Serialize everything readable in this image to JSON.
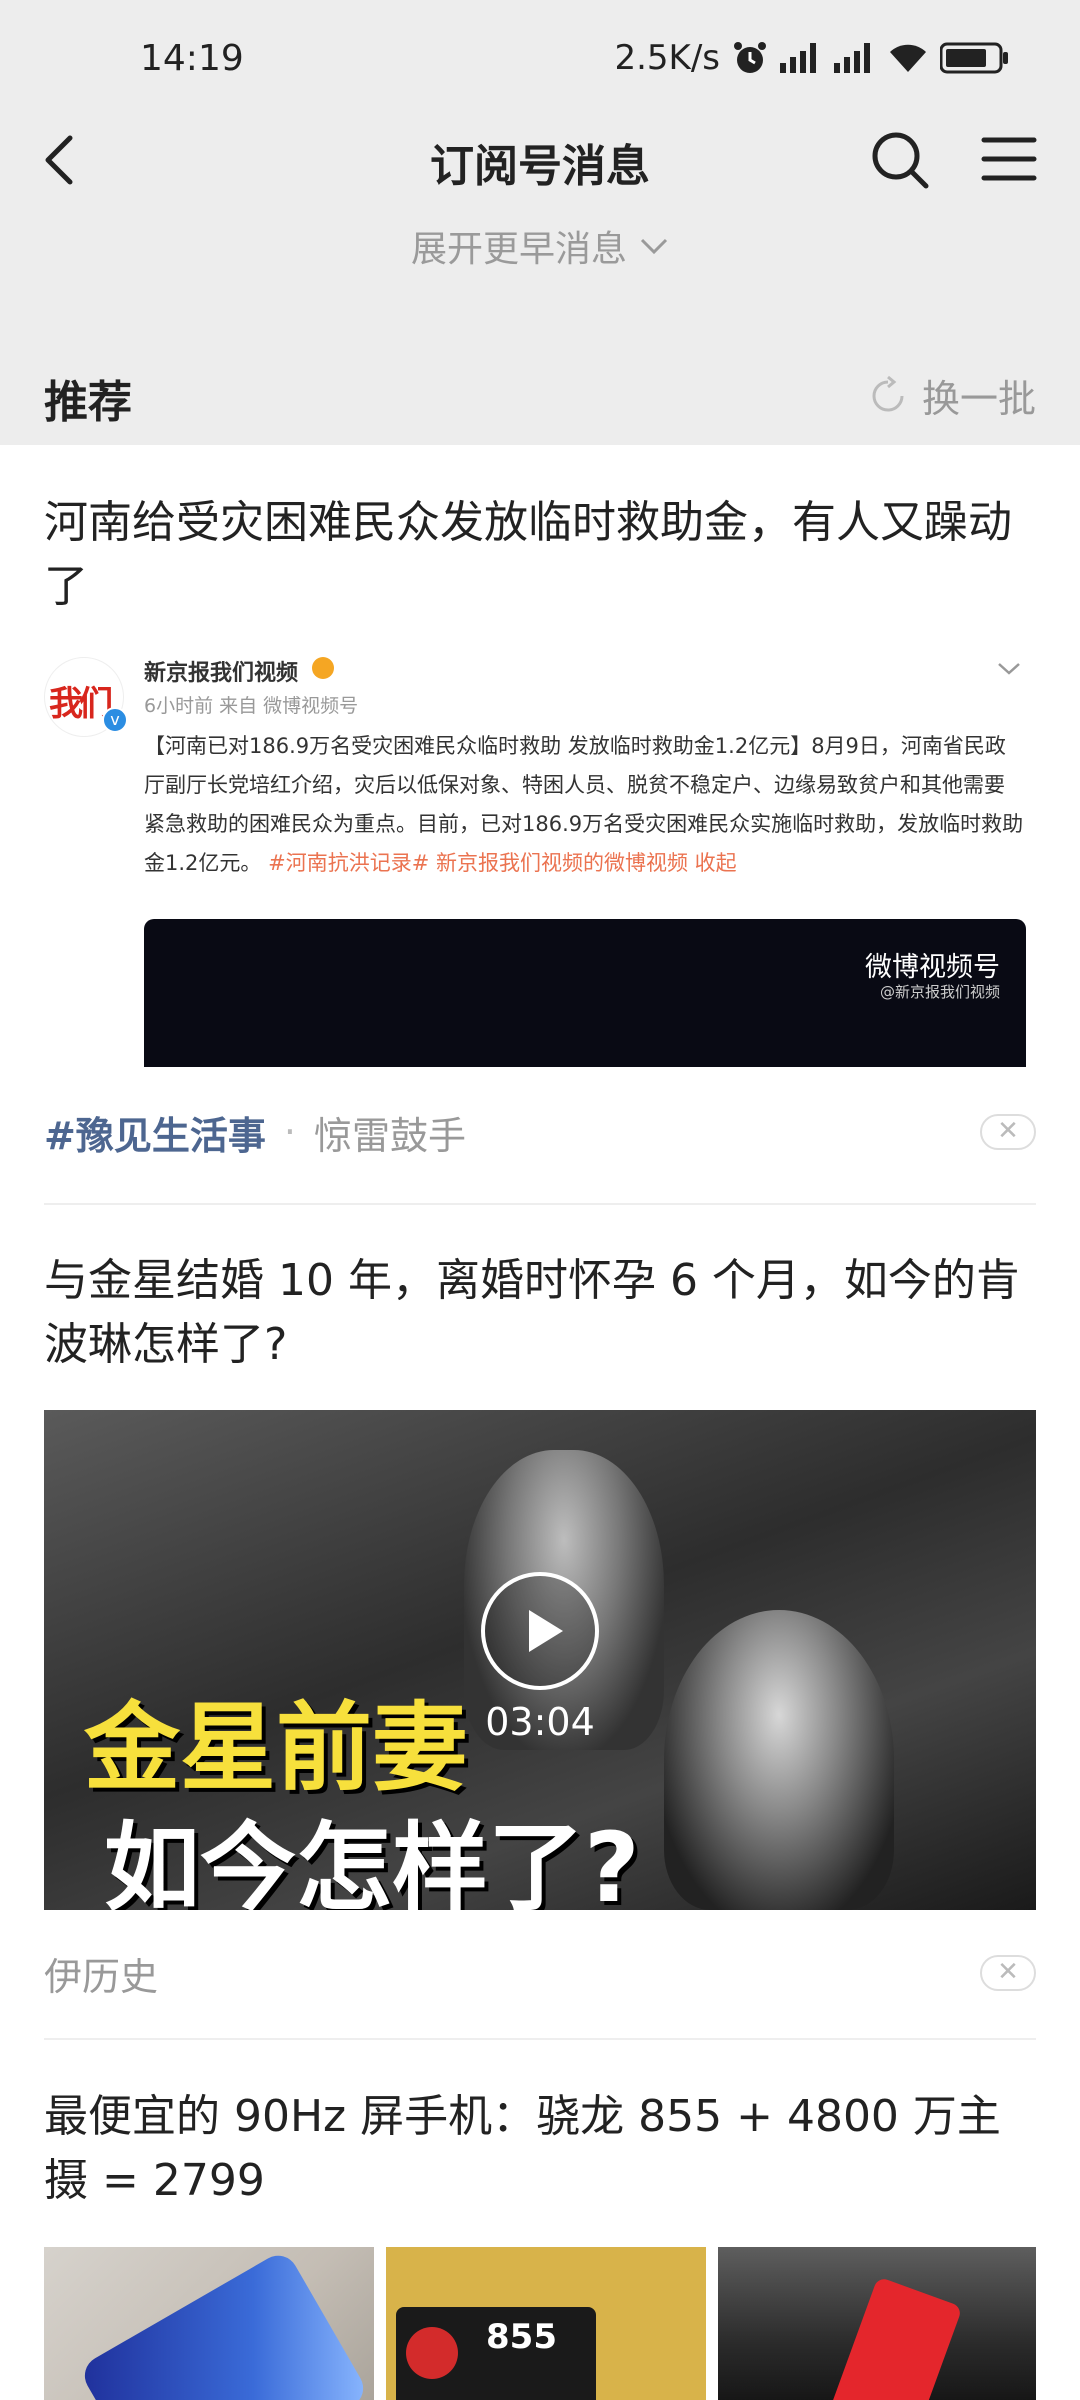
{
  "status_bar": {
    "time": "14:19",
    "net_speed": "2.5K/s",
    "icons": [
      "alarm-icon",
      "signal-icon",
      "signal-icon",
      "wifi-icon",
      "battery-icon"
    ]
  },
  "nav": {
    "title": "订阅号消息",
    "back_icon": "back-arrow-icon",
    "search_icon": "search-icon",
    "menu_icon": "menu-icon"
  },
  "expand": {
    "label": "展开更早消息"
  },
  "recommend": {
    "title": "推荐",
    "refresh_label": "换一批"
  },
  "articles": [
    {
      "headline": "河南给受灾困难民众发放临时救助金，有人又躁动了",
      "weibo": {
        "avatar_text": "我们",
        "name": "新京报我们视频",
        "meta": "6小时前  来自 微博视频号",
        "body_text": "【河南已对186.9万名受灾困难民众临时救助 发放临时救助金1.2亿元】8月9日，河南省民政厅副厅长党培红介绍，灾后以低保对象、特困人员、脱贫不稳定户、边缘易致贫户和其他需要紧急救助的困难民众为重点。目前，已对186.9万名受灾困难民众实施临时救助，发放临时救助金1.2亿元。",
        "body_tags": "#河南抗洪记录# 新京报我们视频的微博视频 收起",
        "video_logo": "微博视频号",
        "video_sub": "@新京报我们视频"
      },
      "topic": "#豫见生活事",
      "source": "惊雷鼓手"
    },
    {
      "headline": "与金星结婚 10 年，离婚时怀孕 6 个月，如今的肯波琳怎样了?",
      "video": {
        "line1": "金星前妻",
        "line2": "如今怎样了?",
        "duration": "03:04"
      },
      "source": "伊历史"
    },
    {
      "headline": "最便宜的 90Hz 屏手机：骁龙 855 + 4800 万主摄 = 2799",
      "images": [
        {
          "name": "phone-photo"
        },
        {
          "name": "chip-photo",
          "label": "855"
        },
        {
          "name": "red-phone-photo"
        }
      ]
    }
  ],
  "colors": {
    "header_bg": "#ededed",
    "topic_blue": "#4d6690",
    "weibo_tag_orange": "#eb7350"
  }
}
